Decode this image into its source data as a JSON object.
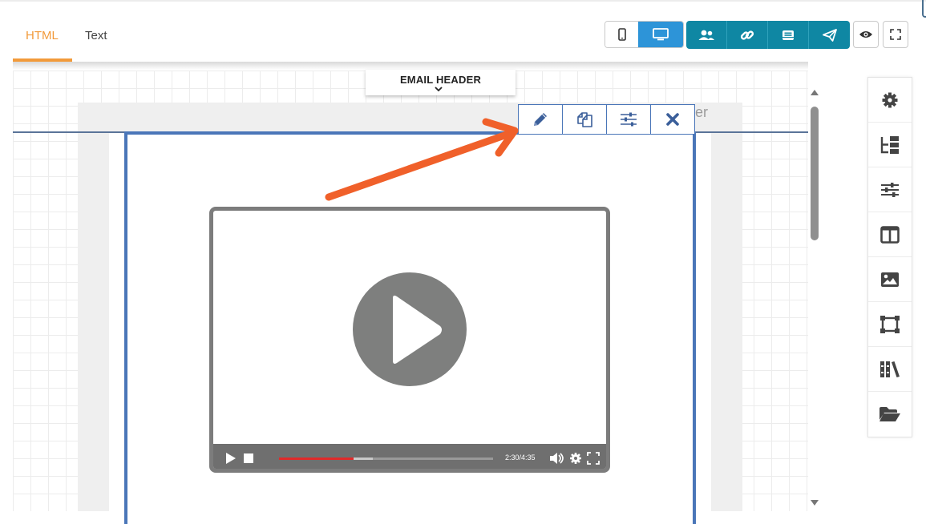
{
  "tabs": [
    {
      "label": "HTML",
      "active": true
    },
    {
      "label": "Text",
      "active": false
    }
  ],
  "toolbar": {
    "device_buttons": [
      {
        "name": "mobile-icon",
        "active": false
      },
      {
        "name": "desktop-icon",
        "active": true
      }
    ],
    "action_buttons": [
      "users-icon",
      "link-icon",
      "inbox-icon",
      "send-icon"
    ],
    "extra_buttons": [
      "eye-icon",
      "fullscreen-icon"
    ]
  },
  "email_header": {
    "label": "EMAIL HEADER"
  },
  "canvas": {
    "placeholder_partial": "ser"
  },
  "block_toolbar": [
    "pencil-icon",
    "copy-icon",
    "sliders-icon",
    "close-icon"
  ],
  "video": {
    "time": "2:30/4:35",
    "progress_fraction": 0.35,
    "buffered_fraction": 0.44
  },
  "right_panel": [
    "gear-icon",
    "layers-icon",
    "sliders-icon",
    "columns-icon",
    "image-icon",
    "resize-icon",
    "library-icon",
    "folder-icon"
  ],
  "colors": {
    "accent_orange": "#f29a3a",
    "active_blue": "#2d94d8",
    "action_teal": "#0f87a3",
    "selection_blue": "#4a76b8",
    "arrow_orange": "#f0602a"
  }
}
